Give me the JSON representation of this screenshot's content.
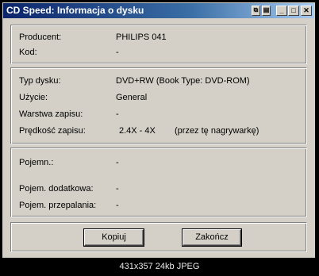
{
  "window": {
    "title": "CD Speed: Informacja o dysku"
  },
  "titlebar_buttons": {
    "minimize": "_",
    "maximize": "□",
    "close": "✕"
  },
  "drive": {
    "producer_label": "Producent:",
    "producer_value": "PHILIPS 041",
    "code_label": "Kod:",
    "code_value": "-"
  },
  "disc": {
    "type_label": "Typ dysku:",
    "type_value": "DVD+RW (Book Type: DVD-ROM)",
    "usage_label": "Użycie:",
    "usage_value": "General",
    "layer_label": "Warstwa zapisu:",
    "layer_value": "-",
    "speed_label": "Prędkość zapisu:",
    "speed_value": "2.4X - 4X",
    "speed_note": "(przez tę nagrywarkę)"
  },
  "capacity": {
    "capacity_label": "Pojemn.:",
    "capacity_value": "-",
    "extra_label": "Pojem. dodatkowa:",
    "extra_value": "-",
    "overburn_label": "Pojem. przepalania:",
    "overburn_value": "-"
  },
  "buttons": {
    "copy": "Kopiuj",
    "close": "Zakończ"
  },
  "image_caption": "431x357 24kb JPEG"
}
